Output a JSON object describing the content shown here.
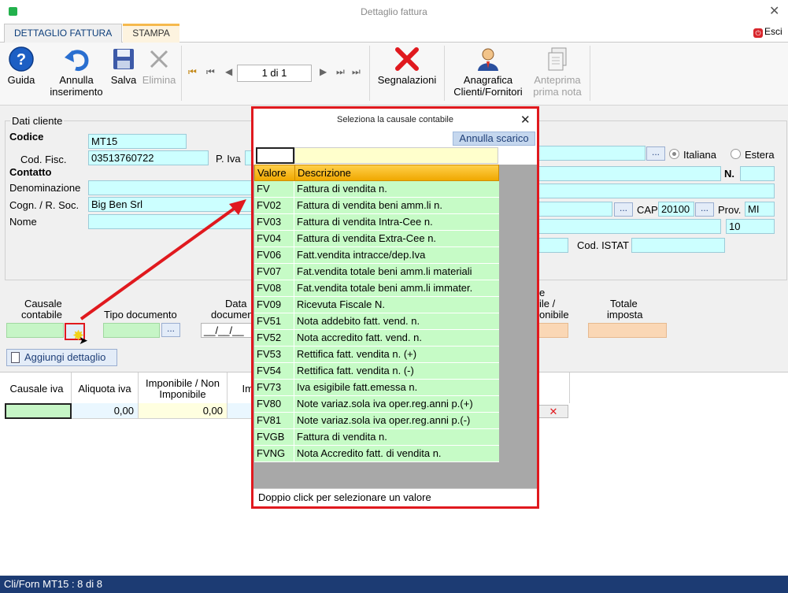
{
  "window": {
    "title": "Dettaglio fattura"
  },
  "tabs": [
    {
      "label": "DETTAGLIO FATTURA"
    },
    {
      "label": "STAMPA"
    }
  ],
  "exit_label": "Esci",
  "toolbar": {
    "guida": "Guida",
    "annulla_1": "Annulla",
    "annulla_2": "inserimento",
    "salva": "Salva",
    "elimina": "Elimina",
    "page": "1 di 1",
    "segnalazioni": "Segnalazioni",
    "anagrafica_1": "Anagrafica",
    "anagrafica_2": "Clienti/Fornitori",
    "anteprima_1": "Anteprima",
    "anteprima_2": "prima nota"
  },
  "cliente": {
    "group_label": "Dati cliente",
    "codice_label": "Codice",
    "codice_value": "MT15",
    "codfisc_label": "Cod. Fisc.",
    "codfisc_value": "03513760722",
    "piva_label": "P. Iva",
    "contatto_label": "Contatto",
    "denominazione_label": "Denominazione",
    "cognome_label": "Cogn. / R. Soc.",
    "cognome_value": "Big Ben Srl",
    "nome_label": "Nome",
    "italiana_label": "Italiana",
    "estera_label": "Estera",
    "n_label": "N.",
    "cap_label": "CAP",
    "cap_value": "20100",
    "prov_label": "Prov.",
    "prov_value": "MI",
    "civico_value": "10",
    "istat_label": "Cod. ISTAT"
  },
  "documento": {
    "causale_1": "Causale",
    "causale_2": "contabile",
    "tipo_doc": "Tipo documento",
    "data_1": "Data",
    "data_2": "documen",
    "data_value": "__/__/__",
    "imponibile_1": "e",
    "imponibile_2": "ile /",
    "imponibile_3": "onibile",
    "totale_1": "Totale",
    "totale_2": "imposta",
    "dots": "..."
  },
  "aggiungi_label": "Aggiungi dettaglio",
  "grid": {
    "headers": [
      "Causale iva",
      "Aliquota iva",
      "Imponibile / Non",
      "Imponibile",
      "Im"
    ],
    "row": [
      "",
      "0,00",
      "0,00",
      ""
    ]
  },
  "popup": {
    "title": "Seleziona la causale contabile",
    "annulla": "Annulla scarico",
    "col_valore": "Valore",
    "col_descrizione": "Descrizione",
    "rows": [
      {
        "v": "FV",
        "d": "Fattura di vendita n."
      },
      {
        "v": "FV02",
        "d": "Fattura di vendita beni amm.li n."
      },
      {
        "v": "FV03",
        "d": "Fattura di vendita Intra-Cee n."
      },
      {
        "v": "FV04",
        "d": "Fattura di vendita Extra-Cee n."
      },
      {
        "v": "FV06",
        "d": "Fatt.vendita intracce/dep.Iva"
      },
      {
        "v": "FV07",
        "d": "Fat.vendita totale beni amm.li materiali"
      },
      {
        "v": "FV08",
        "d": "Fat.vendita totale beni amm.li immater."
      },
      {
        "v": "FV09",
        "d": "Ricevuta Fiscale N."
      },
      {
        "v": "FV51",
        "d": "Nota addebito fatt. vend. n."
      },
      {
        "v": "FV52",
        "d": "Nota accredito fatt. vend. n."
      },
      {
        "v": "FV53",
        "d": "Rettifica fatt. vendita n. (+)"
      },
      {
        "v": "FV54",
        "d": "Rettifica fatt. vendita n. (-)"
      },
      {
        "v": "FV73",
        "d": "Iva esigibile fatt.emessa n."
      },
      {
        "v": "FV80",
        "d": "Note variaz.sola iva oper.reg.anni p.(+)"
      },
      {
        "v": "FV81",
        "d": "Note variaz.sola iva oper.reg.anni p.(-)"
      },
      {
        "v": "FVGB",
        "d": "Fattura di vendita n."
      },
      {
        "v": "FVNG",
        "d": "Nota Accredito fatt. di vendita n."
      }
    ],
    "footer": "Doppio click per selezionare un valore"
  },
  "status": "Cli/Forn MT15 : 8 di 8",
  "colors": {
    "accent": "#1c3b73",
    "highlight": "#e0191e",
    "list_row": "#c6fbc6",
    "header": "#f0a800"
  }
}
